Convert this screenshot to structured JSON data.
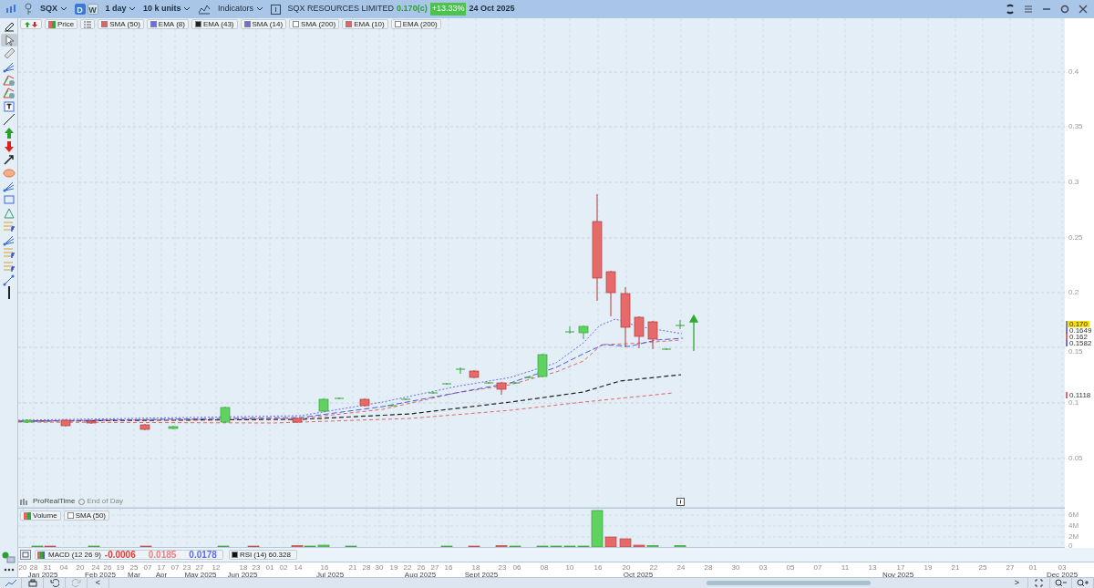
{
  "toolbar": {
    "symbol": "SQX",
    "periods": [
      {
        "label": "D",
        "selected": true
      },
      {
        "label": "W",
        "selected": false
      }
    ],
    "interval": "1 day",
    "units": "10 k units",
    "indicators_button": "Indicators",
    "instrument": "SQX RESOURCES LIMITED",
    "last_price": "0.170(c)",
    "change": "+13.33%",
    "date": "24 Oct 2025"
  },
  "left_toolbar": [
    {
      "kind": "pencil",
      "selected": false
    },
    {
      "kind": "pointer",
      "selected": true
    },
    {
      "kind": "ruler",
      "selected": false
    },
    {
      "kind": "fan",
      "selected": false
    },
    {
      "kind": "gann",
      "selected": false
    },
    {
      "kind": "gann",
      "selected": false
    },
    {
      "kind": "text",
      "selected": false
    },
    {
      "kind": "line",
      "selected": false
    },
    {
      "kind": "up",
      "selected": false
    },
    {
      "kind": "down",
      "selected": false
    },
    {
      "kind": "arrow",
      "selected": false
    },
    {
      "kind": "ellipse",
      "selected": false
    },
    {
      "kind": "fan",
      "selected": false
    },
    {
      "kind": "rect",
      "selected": false
    },
    {
      "kind": "triangle",
      "selected": false
    },
    {
      "kind": "fib",
      "selected": false
    },
    {
      "kind": "fan",
      "selected": false
    },
    {
      "kind": "fib",
      "selected": false
    },
    {
      "kind": "fib",
      "selected": false
    },
    {
      "kind": "measure",
      "selected": false
    },
    {
      "kind": "vline",
      "selected": false
    }
  ],
  "legend": {
    "arrows_on": true,
    "list_on": true,
    "price_label": "Price",
    "indicators": [
      {
        "name": "SMA",
        "params": "(50)",
        "color": "#e06666"
      },
      {
        "name": "EMA",
        "params": "(8)",
        "color": "#6b6bf0"
      },
      {
        "name": "EMA",
        "params": "(43)",
        "color": "#222222"
      },
      {
        "name": "SMA",
        "params": "(14)",
        "color": "#6b6bf0"
      },
      {
        "name": "SMA",
        "params": "(200)",
        "color": "#ffffff"
      },
      {
        "name": "EMA",
        "params": "(10)",
        "color": "#e06666"
      },
      {
        "name": "EMA",
        "params": "(200)",
        "color": "#ffffff"
      }
    ]
  },
  "price_axis": {
    "ticks": [
      "0.4",
      "0.35",
      "0.3",
      "0.25",
      "0.2",
      "0.15",
      "0.1",
      "0.05"
    ],
    "markers": [
      {
        "text": "0.170",
        "color": "#f5e000"
      },
      {
        "text": "0.1649",
        "color": "#6b6bf0"
      },
      {
        "text": "0.162",
        "color": "#e06666"
      },
      {
        "text": "0.1582",
        "color": "#6b6bf0"
      },
      {
        "text": "0.1118",
        "color": "#e06666"
      }
    ]
  },
  "source": {
    "provider": "ProRealTime",
    "mode": "End of Day"
  },
  "volume": {
    "label": "Volume",
    "sma": "SMA (50)",
    "ticks": [
      "6M",
      "4M",
      "2M",
      "0"
    ]
  },
  "macd": {
    "label": "MACD",
    "params": "(12 26 9)",
    "values": [
      {
        "text": "-0.0006",
        "color": "#e53935"
      },
      {
        "text": "0.0185",
        "color": "#ef7f7f"
      },
      {
        "text": "0.0178",
        "color": "#5c6bf0"
      }
    ]
  },
  "rsi": {
    "label": "RSI",
    "params": "(14)",
    "value": "60.328"
  },
  "dates": {
    "days": [
      "20",
      "28",
      "31",
      "04",
      "20",
      "24",
      "26",
      "19",
      "25",
      "07",
      "17",
      "07",
      "23",
      "27",
      "12",
      "18",
      "23",
      "01",
      "02",
      "14",
      "16",
      "21",
      "28",
      "30",
      "19",
      "22",
      "26",
      "27",
      "16",
      "18",
      "23",
      "06",
      "08",
      "10",
      "16",
      "20",
      "22",
      "24",
      "28",
      "30",
      "03",
      "05",
      "07",
      "11",
      "13",
      "17",
      "19",
      "21",
      "25",
      "27",
      "01",
      "03"
    ],
    "months": [
      "Jan 2025",
      "Feb 2025",
      "Mar",
      "Apr",
      "May 2025",
      "Jun 2025",
      "Jul 2025",
      "Aug 2025",
      "Sept 2025",
      "Oct 2025",
      "Nov 2025",
      "Dec 2025"
    ]
  },
  "bottom_toolbar": {
    "scroll_left": "<",
    "scroll_right": ">"
  }
}
